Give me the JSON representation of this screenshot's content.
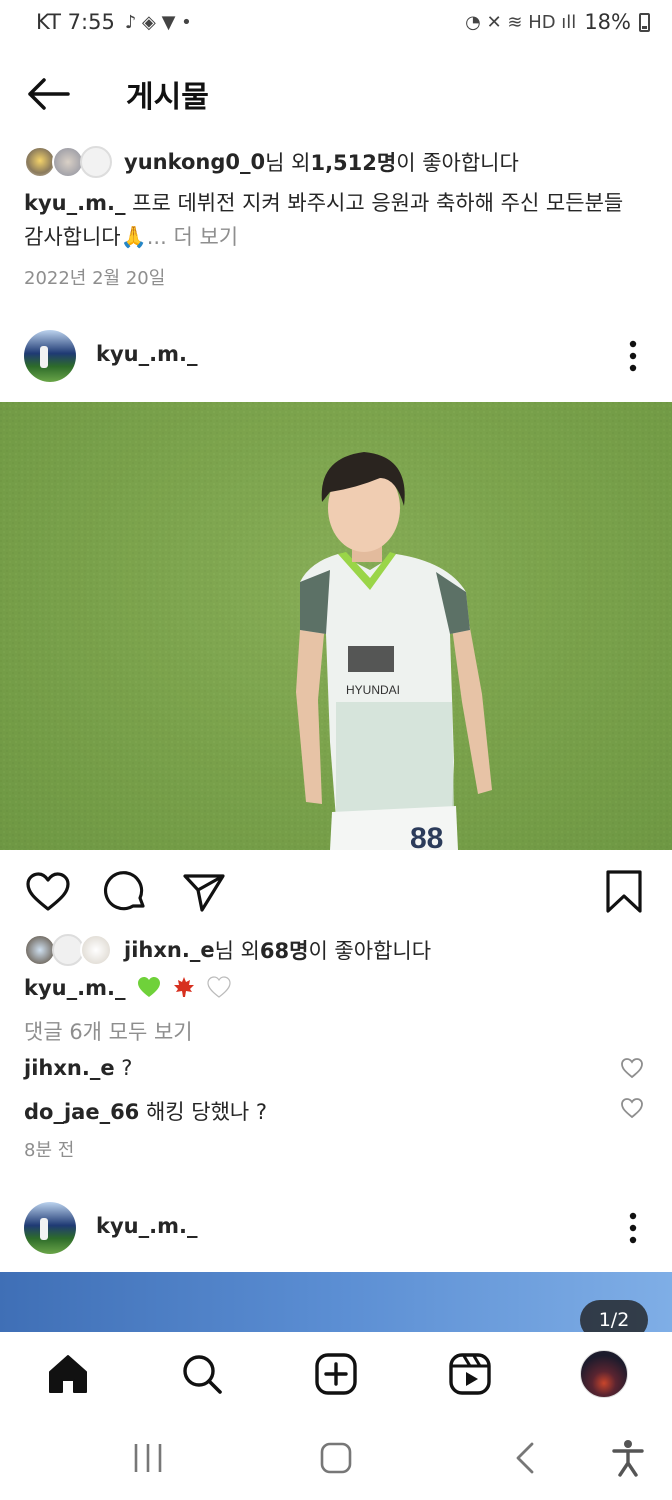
{
  "status_bar": {
    "carrier_time": "KT 7:55",
    "battery": "18%"
  },
  "header": {
    "title": "게시물"
  },
  "prev_post": {
    "liked_by_user": "yunkong0_0",
    "liked_suffix_1": "님 외 ",
    "liked_count": "1,512명",
    "liked_suffix_2": "이 좋아합니다",
    "caption_user": "kyu_.m._",
    "caption_text": " 프로 데뷔전 지켜 봐주시고 응원과 축하해 주신 모든분들 감사합니다🙏",
    "more_label": "... 더 보기",
    "date": "2022년 2월 20일"
  },
  "post": {
    "username": "kyu_.m._",
    "liked_by_user": "jihxn._e",
    "liked_suffix_1": "님 외 ",
    "liked_count": "68명",
    "liked_suffix_2": "이 좋아합니다",
    "caption_user": "kyu_.m._",
    "view_comments": "댓글 6개 모두 보기",
    "comments": [
      {
        "user": "jihxn._e",
        "text": " ?"
      },
      {
        "user": "do_jae_66",
        "text": " 해킹 당했나 ?"
      }
    ],
    "time_ago": "8분 전"
  },
  "next_post": {
    "username": "kyu_.m._",
    "counter": "1/2"
  },
  "icons": {
    "back": "arrow-left-icon",
    "more": "kebab-icon",
    "like": "heart-icon",
    "comment": "comment-bubble-icon",
    "share": "send-icon",
    "save": "bookmark-icon",
    "home": "home-icon",
    "search": "search-icon",
    "create": "plus-square-icon",
    "reels": "reels-icon",
    "profile": "profile-avatar"
  },
  "colors": {
    "text": "#262626",
    "muted": "#8e8e8e",
    "pitch": "#78a04a"
  }
}
